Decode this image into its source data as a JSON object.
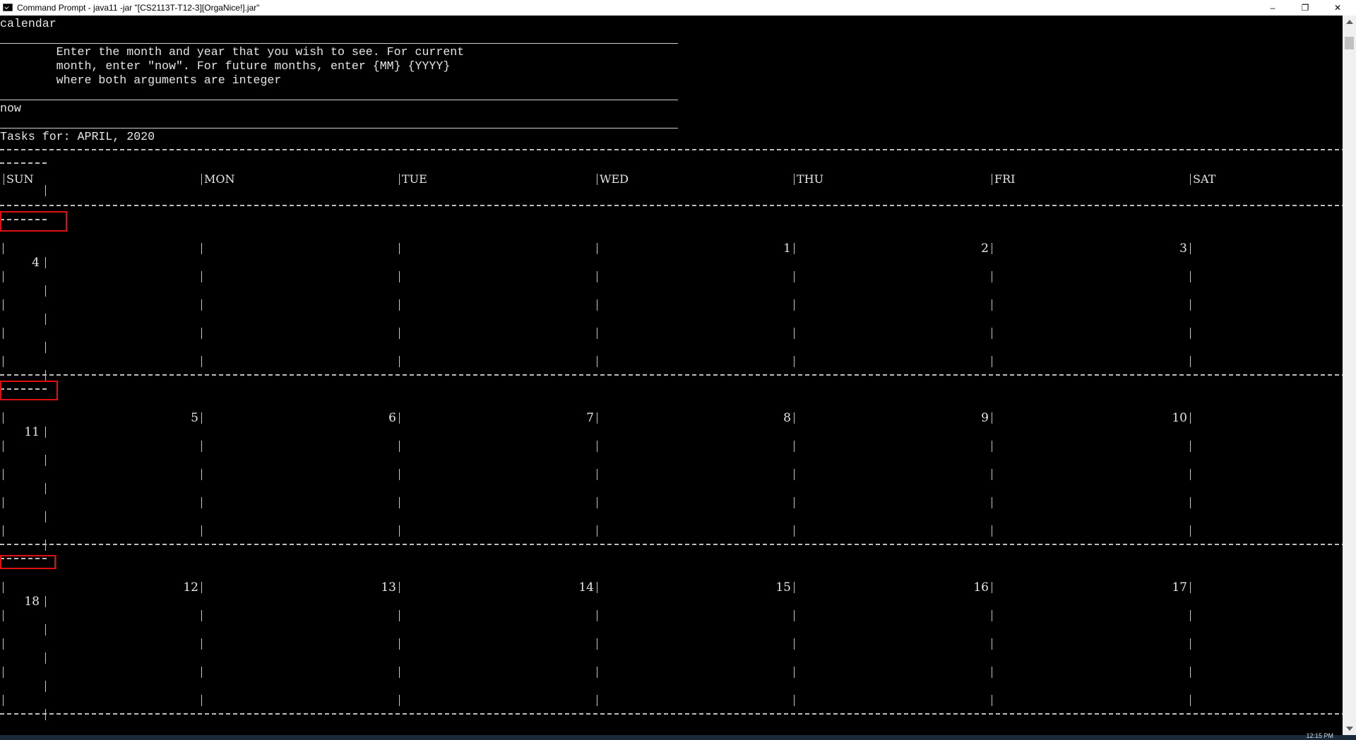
{
  "window": {
    "title": "Command Prompt - java11  -jar \"[CS2113T-T12-3][OrgaNice!].jar\"",
    "controls": {
      "minimize": "–",
      "maximize": "❐",
      "close": "✕"
    }
  },
  "console": {
    "command": "calendar",
    "help_lines": [
      "        Enter the month and year that you wish to see. For current",
      "        month, enter \"now\". For future months, enter {MM} {YYYY}",
      "        where both arguments are integer"
    ],
    "input": "now",
    "tasks_header": "Tasks for: APRIL, 2020"
  },
  "calendar": {
    "month": "APRIL",
    "year": "2020",
    "days_of_week": [
      "SUN",
      "MON",
      "TUE",
      "WED",
      "THU",
      "FRI",
      "SAT"
    ],
    "weeks": [
      {
        "sun": "4",
        "dates": [
          "",
          "",
          "",
          "1",
          "2",
          "3"
        ]
      },
      {
        "sun": "11",
        "dates": [
          "5",
          "6",
          "7",
          "8",
          "9",
          "10"
        ]
      },
      {
        "sun": "18",
        "dates": [
          "12",
          "13",
          "14",
          "15",
          "16",
          "17"
        ]
      }
    ]
  },
  "taskbar": {
    "clock": "12:15 PM"
  },
  "colors": {
    "highlight": "#e01010",
    "console_bg": "#000000",
    "console_fg": "#e6e6e6"
  }
}
